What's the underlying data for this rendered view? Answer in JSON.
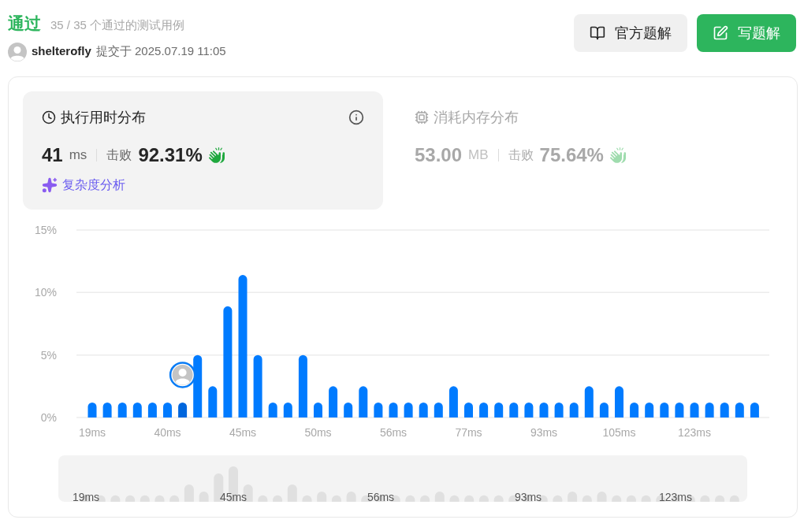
{
  "header": {
    "status": "通过",
    "cases": "35 / 35 个通过的测试用例",
    "user": "shelterofly",
    "submitted": "提交于 2025.07.19 11:05"
  },
  "buttons": [
    {
      "label": "官方题解",
      "kind": "secondary"
    },
    {
      "label": "写题解",
      "kind": "primary"
    }
  ],
  "stats": [
    {
      "kind": "time",
      "title": "执行用时分布",
      "selected": true,
      "value": "41",
      "unit": "ms",
      "beats_label": "击败",
      "beats": "92.31%",
      "link": "复杂度分析"
    },
    {
      "kind": "memory",
      "title": "消耗内存分布",
      "selected": false,
      "value": "53.00",
      "unit": "MB",
      "beats_label": "击败",
      "beats": "75.64%"
    }
  ],
  "chart": {
    "chart_data": {
      "type": "bar",
      "stacked": true,
      "categories": [
        "19ms",
        null,
        null,
        null,
        null,
        "40ms",
        null,
        null,
        null,
        null,
        "45ms",
        null,
        null,
        null,
        null,
        "50ms",
        null,
        null,
        null,
        null,
        "56ms",
        null,
        null,
        null,
        null,
        "77ms",
        null,
        null,
        null,
        null,
        "93ms",
        null,
        null,
        null,
        null,
        "105ms",
        null,
        null,
        null,
        null,
        "123ms",
        null,
        null,
        null,
        null
      ],
      "series": [
        {
          "color": "#007bff",
          "values": [
            1.2,
            1.2,
            1.2,
            1.2,
            1.2,
            1.2,
            null,
            5.0,
            2.5,
            8.9,
            11.4,
            5.0,
            1.2,
            1.2,
            5.0,
            1.2,
            2.5,
            1.2,
            2.5,
            1.2,
            1.2,
            1.2,
            1.2,
            1.2,
            2.5,
            1.2,
            1.2,
            1.2,
            1.2,
            1.2,
            1.2,
            1.2,
            1.2,
            2.5,
            1.2,
            2.5,
            1.2,
            1.2,
            1.2,
            1.2,
            1.2,
            1.2,
            1.2,
            1.2,
            1.2
          ]
        },
        {
          "color": "#0066dd",
          "values": [
            null,
            null,
            null,
            null,
            null,
            null,
            1.2,
            null,
            null,
            null,
            null,
            null,
            null,
            null,
            null,
            null,
            null,
            null,
            null,
            null,
            null,
            null,
            null,
            null,
            null,
            null,
            null,
            null,
            null,
            null,
            null,
            null,
            null,
            null,
            null,
            null,
            null,
            null,
            null,
            null,
            null,
            null,
            null,
            null,
            null
          ]
        }
      ],
      "ylim": [
        0,
        15
      ],
      "yticks": [
        {
          "value": 0,
          "label": "0%"
        },
        {
          "value": 5,
          "label": "5%"
        },
        {
          "value": 10,
          "label": "10%"
        },
        {
          "value": 15,
          "label": "15%"
        }
      ]
    }
  },
  "overview": {
    "labels": [
      "19ms",
      "45ms",
      "56ms",
      "93ms",
      "123ms"
    ]
  }
}
